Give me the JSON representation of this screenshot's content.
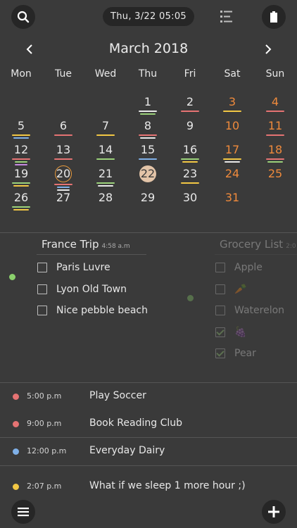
{
  "header": {
    "datetime": "Thu, 3/22  05:05"
  },
  "calendar": {
    "title": "March 2018",
    "weekdays": [
      "Mon",
      "Tue",
      "Wed",
      "Thu",
      "Fri",
      "Sat",
      "Sun"
    ],
    "rows": [
      [
        {
          "d": ""
        },
        {
          "d": ""
        },
        {
          "d": ""
        },
        {
          "d": "1",
          "bars": [
            "#e9e9e9",
            "#9bd17a"
          ]
        },
        {
          "d": "2",
          "bars": [
            "#e57373"
          ]
        },
        {
          "d": "3",
          "weekend": true,
          "bars": [
            "#f2c744"
          ]
        },
        {
          "d": "4",
          "weekend": true,
          "bars": [
            "#e57373"
          ]
        }
      ],
      [
        {
          "d": "5",
          "bars": [
            "#f2c744",
            "#7fb0e8"
          ]
        },
        {
          "d": "6",
          "bars": [
            "#e57373"
          ]
        },
        {
          "d": "7",
          "bars": [
            "#f2c744"
          ]
        },
        {
          "d": "8",
          "bars": [
            "#e57373",
            "#e9e9e9"
          ]
        },
        {
          "d": "9"
        },
        {
          "d": "10",
          "weekend": true
        },
        {
          "d": "11",
          "weekend": true,
          "bars": [
            "#e57373"
          ]
        }
      ],
      [
        {
          "d": "12",
          "bars": [
            "#e57373",
            "#9bd17a",
            "#c58ae0"
          ]
        },
        {
          "d": "13",
          "bars": [
            "#e57373"
          ]
        },
        {
          "d": "14",
          "bars": [
            "#9bd17a"
          ]
        },
        {
          "d": "15",
          "bars": [
            "#7fb0e8"
          ]
        },
        {
          "d": "16",
          "bars": [
            "#9bd17a",
            "#f2c744"
          ]
        },
        {
          "d": "17",
          "weekend": true,
          "bars": [
            "#f2c744",
            "#e9e9e9"
          ]
        },
        {
          "d": "18",
          "weekend": true,
          "bars": [
            "#e57373",
            "#9bd17a"
          ]
        }
      ],
      [
        {
          "d": "19",
          "bars": [
            "#9bd17a",
            "#f2c744"
          ]
        },
        {
          "d": "20",
          "today": true,
          "bars": [
            "#e57373",
            "#7fb0e8",
            "#e9e9e9"
          ]
        },
        {
          "d": "21",
          "bars": [
            "#9bd17a",
            "#e9e9e9"
          ]
        },
        {
          "d": "22",
          "selected": true,
          "bars": []
        },
        {
          "d": "23",
          "bars": [
            "#f2c744"
          ]
        },
        {
          "d": "24",
          "weekend": true
        },
        {
          "d": "25",
          "weekend": true
        }
      ],
      [
        {
          "d": "26",
          "bars": [
            "#9bd17a",
            "#f2c744"
          ]
        },
        {
          "d": "27"
        },
        {
          "d": "28"
        },
        {
          "d": "29"
        },
        {
          "d": "30"
        },
        {
          "d": "31",
          "weekend": true
        },
        {
          "d": ""
        }
      ]
    ]
  },
  "lists": [
    {
      "title": "France Trip",
      "time": "4:58 a.m",
      "items": [
        {
          "label": "Paris Luvre",
          "checked": false
        },
        {
          "label": "Lyon Old Town",
          "checked": false
        },
        {
          "label": "Nice pebble beach",
          "checked": false
        }
      ],
      "dot_color": "#8bd16c"
    },
    {
      "title": "Grocery List",
      "time": "2:0",
      "items": [
        {
          "label": "Apple",
          "checked": false
        },
        {
          "label": "🥕",
          "checked": false
        },
        {
          "label": "Waterelon",
          "checked": false
        },
        {
          "label": "🍇",
          "checked": true
        },
        {
          "label": "Pear",
          "checked": true
        }
      ],
      "dot_color": "#8bd16c"
    }
  ],
  "events": [
    {
      "time": "5:00 p.m",
      "title": "Play Soccer",
      "color": "#e57373"
    },
    {
      "time": "9:00 p.m",
      "title": "Book Reading Club",
      "color": "#e57373"
    },
    {
      "time": "12:00 p.m",
      "title": "Everyday Dairy",
      "color": "#7fb0e8"
    },
    {
      "time": "2:07 p.m",
      "title": "What if we sleep 1 more hour ;)",
      "color": "#f2c744"
    }
  ]
}
